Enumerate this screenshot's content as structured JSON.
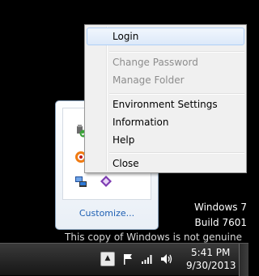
{
  "context_menu": {
    "items": [
      {
        "label": "Login",
        "enabled": true,
        "highlighted": true
      },
      {
        "label": "Change Password",
        "enabled": false
      },
      {
        "label": "Manage Folder",
        "enabled": false
      },
      {
        "label": "Environment Settings",
        "enabled": true
      },
      {
        "label": "Information",
        "enabled": true
      },
      {
        "label": "Help",
        "enabled": true
      },
      {
        "label": "Close",
        "enabled": true
      }
    ]
  },
  "tray_panel": {
    "customize_label": "Customize...",
    "icons": [
      "usb-device-icon",
      "orange-app-icon",
      "network-app-icon",
      "purple-app-icon"
    ]
  },
  "watermark": {
    "os": "Windows 7",
    "build": "Build 7601",
    "genuine": "This copy of Windows is not genuine"
  },
  "taskbar": {
    "time": "5:41 PM",
    "date": "9/30/2013",
    "tray_icons": [
      "flag-icon",
      "signal-icon",
      "volume-icon"
    ]
  },
  "colors": {
    "menu_bg": "#f0f0f0",
    "highlight": "#dde9f9",
    "link": "#1e5fb3",
    "disabled_text": "#8d8d8d"
  }
}
